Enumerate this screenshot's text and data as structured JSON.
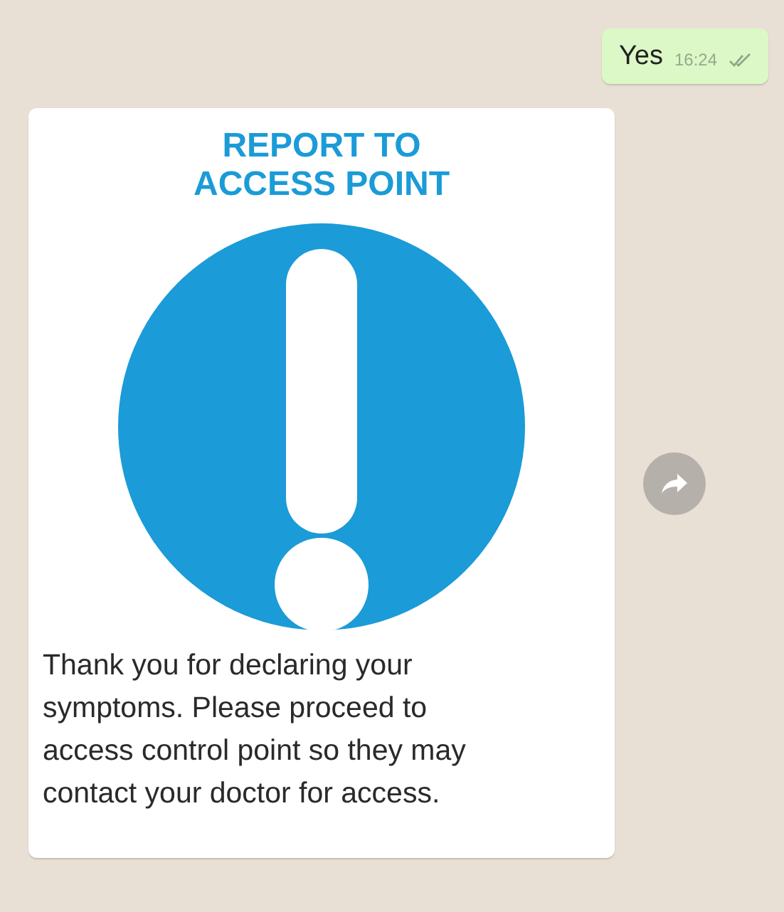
{
  "messages": [
    {
      "kind": "text",
      "outgoing": true,
      "text": "Yes",
      "time": "16:24",
      "read": false
    },
    {
      "kind": "image",
      "outgoing": false,
      "heading": [
        "REPORT TO",
        "ACCESS POINT"
      ],
      "caption": "Thank you for declaring your symptoms. Please proceed to access control point so they may contact your doctor for access.",
      "forwardable": true
    }
  ]
}
